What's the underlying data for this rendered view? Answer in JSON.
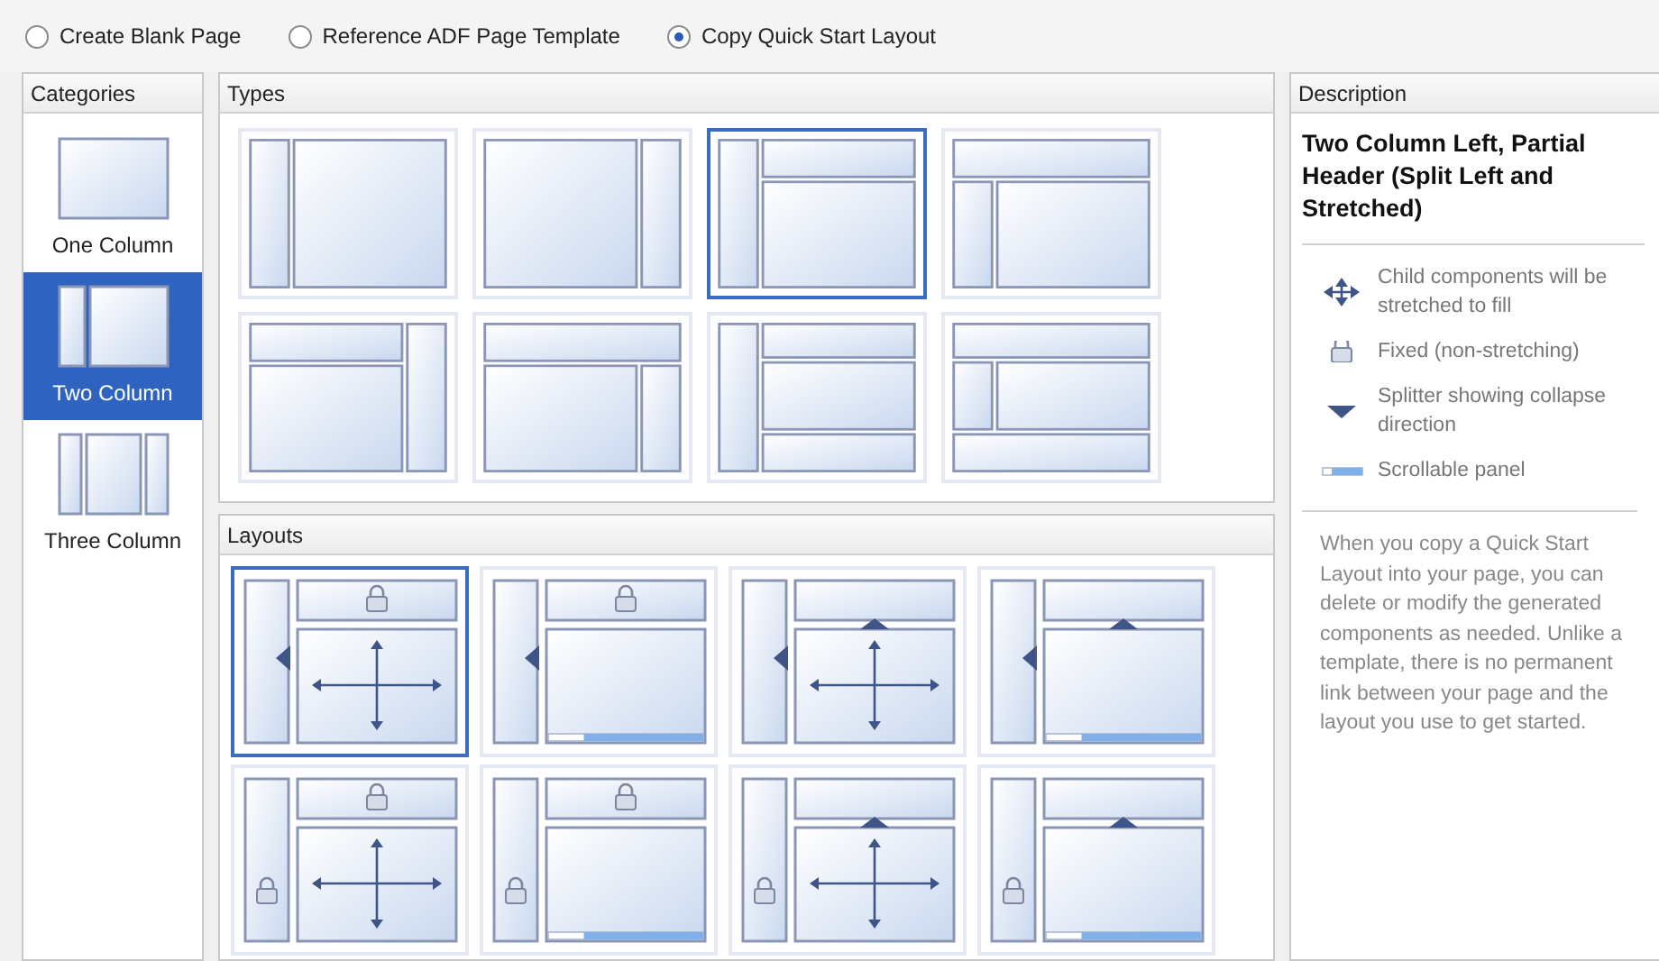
{
  "options": [
    {
      "label": "Create Blank Page",
      "selected": false
    },
    {
      "label": "Reference ADF Page Template",
      "selected": false
    },
    {
      "label": "Copy Quick Start Layout",
      "selected": true
    }
  ],
  "categories": {
    "title": "Categories",
    "items": [
      {
        "label": "One Column",
        "kind": "one",
        "selected": false
      },
      {
        "label": "Two Column",
        "kind": "two",
        "selected": true
      },
      {
        "label": "Three Column",
        "kind": "three",
        "selected": false
      }
    ]
  },
  "types": {
    "title": "Types",
    "items": [
      {
        "kind": "left-main",
        "selected": false
      },
      {
        "kind": "main-right",
        "selected": false
      },
      {
        "kind": "left-header-main",
        "selected": true
      },
      {
        "kind": "header-left-main",
        "selected": false
      },
      {
        "kind": "header-main-right",
        "selected": false
      },
      {
        "kind": "header-main-right-below",
        "selected": false
      },
      {
        "kind": "left-header-main-footer",
        "selected": false
      },
      {
        "kind": "header-left-main-footer",
        "selected": false
      }
    ]
  },
  "layouts": {
    "title": "Layouts",
    "items": [
      {
        "left_locked": false,
        "header_locked": true,
        "scrollable": false,
        "selected": true
      },
      {
        "left_locked": false,
        "header_locked": true,
        "scrollable": true,
        "selected": false
      },
      {
        "left_locked": false,
        "header_locked": false,
        "scrollable": false,
        "selected": false
      },
      {
        "left_locked": false,
        "header_locked": false,
        "scrollable": true,
        "selected": false
      },
      {
        "left_locked": true,
        "header_locked": true,
        "scrollable": false,
        "selected": false
      },
      {
        "left_locked": true,
        "header_locked": true,
        "scrollable": true,
        "selected": false
      },
      {
        "left_locked": true,
        "header_locked": false,
        "scrollable": false,
        "selected": false
      },
      {
        "left_locked": true,
        "header_locked": false,
        "scrollable": true,
        "selected": false
      }
    ]
  },
  "description": {
    "title": "Description",
    "heading": "Two Column Left, Partial Header (Split Left and Stretched)",
    "legend": [
      {
        "kind": "stretch",
        "text": "Child components will be stretched to fill"
      },
      {
        "kind": "fixed",
        "text": "Fixed (non-stretching)"
      },
      {
        "kind": "splitter",
        "text": "Splitter showing collapse direction"
      },
      {
        "kind": "scroll",
        "text": "Scrollable panel"
      }
    ],
    "note": "When you copy a Quick Start Layout into your page, you can delete or modify the generated components as needed. Unlike a template, there is no permanent link between your page and the layout you use to get started."
  }
}
